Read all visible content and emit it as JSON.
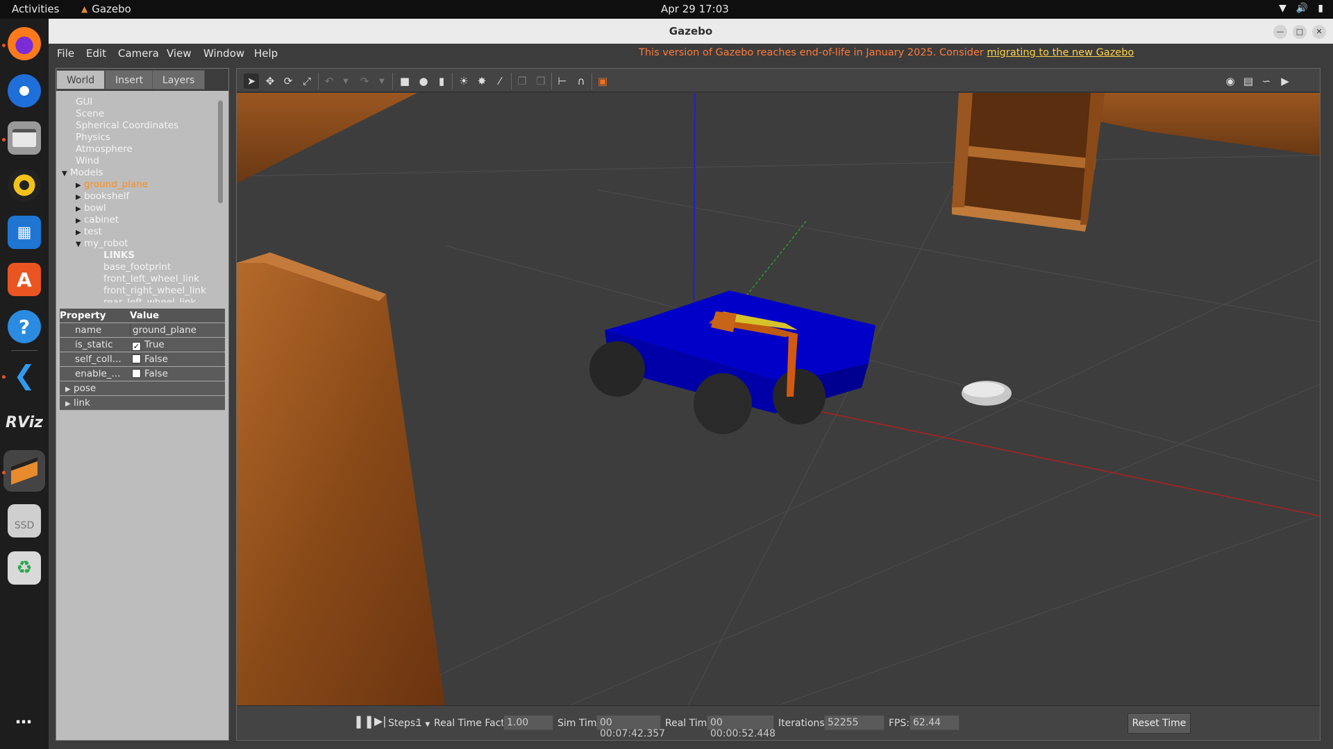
{
  "topbar": {
    "activities": "Activities",
    "app_name": "Gazebo",
    "clock": "Apr 29  17:03"
  },
  "window": {
    "title": "Gazebo"
  },
  "menu": {
    "file": "File",
    "edit": "Edit",
    "camera": "Camera",
    "view": "View",
    "window": "Window",
    "help": "Help"
  },
  "notice": {
    "text": "This version of Gazebo reaches end-of-life in January 2025. Consider ",
    "link": "migrating to the new Gazebo"
  },
  "tabs": {
    "world": "World",
    "insert": "Insert",
    "layers": "Layers"
  },
  "tree": {
    "gui": "GUI",
    "scene": "Scene",
    "spherical": "Spherical Coordinates",
    "physics": "Physics",
    "atmosphere": "Atmosphere",
    "wind": "Wind",
    "models": "Models",
    "model_items": [
      "ground_plane",
      "bookshelf",
      "bowl",
      "cabinet",
      "test",
      "my_robot"
    ],
    "links_header": "LINKS",
    "links": [
      "base_footprint",
      "front_left_wheel_link",
      "front_right_wheel_link",
      "rear_left_wheel_link"
    ]
  },
  "properties": {
    "header_property": "Property",
    "header_value": "Value",
    "rows": [
      {
        "name": "name",
        "value": "ground_plane"
      },
      {
        "name": "is_static",
        "value": "True",
        "checked": true
      },
      {
        "name": "self_coll...",
        "value": "False",
        "checked": false
      },
      {
        "name": "enable_...",
        "value": "False",
        "checked": false
      }
    ],
    "groups": [
      "pose",
      "link"
    ]
  },
  "bottom": {
    "steps_label": "Steps:",
    "steps_value": "1",
    "rtf_label": "Real Time Factor:",
    "rtf_value": "1.00",
    "sim_label": "Sim Time:",
    "sim_value": "00 00:07:42.357",
    "real_label": "Real Time:",
    "real_value": "00 00:00:52.448",
    "iter_label": "Iterations:",
    "iter_value": "52255",
    "fps_label": "FPS:",
    "fps_value": "62.44",
    "reset": "Reset Time"
  },
  "colors": {
    "accent_orange": "#e95420",
    "notice_text": "#ff7a3a",
    "notice_link": "#ffd34a",
    "selected_model": "#ff8c1a",
    "robot_body": "#0000b8"
  },
  "dock_icons": [
    "firefox-icon",
    "thunderbird-icon",
    "files-icon",
    "rhythmbox-icon",
    "writer-icon",
    "app-center-icon",
    "help-icon",
    "vscode-icon",
    "rviz-icon",
    "gazebo-icon",
    "ssd-icon",
    "trash-icon",
    "app-grid-icon"
  ]
}
